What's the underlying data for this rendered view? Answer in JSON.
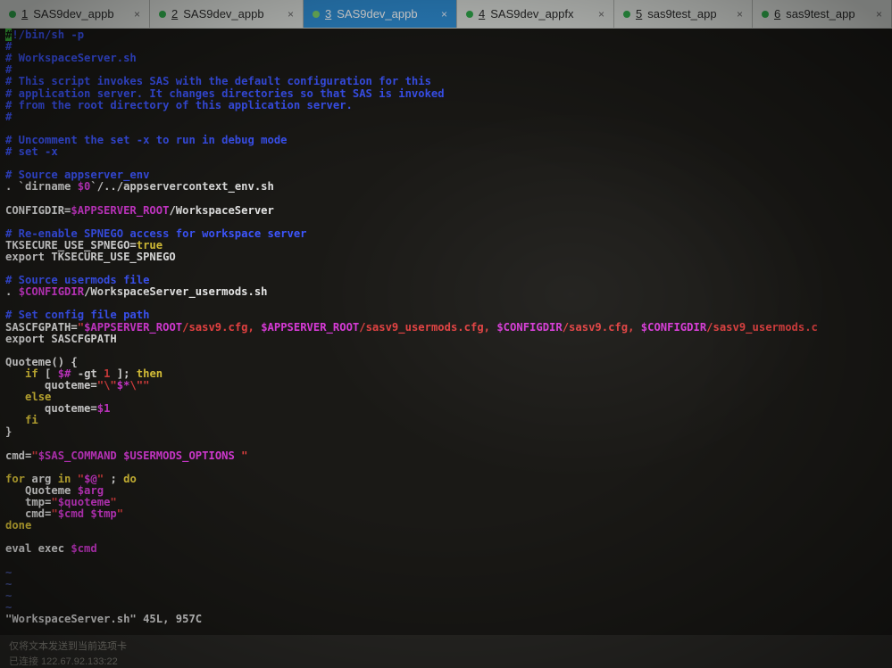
{
  "tabs": [
    {
      "num": "1",
      "label": "SAS9dev_appb",
      "active": false
    },
    {
      "num": "2",
      "label": "SAS9dev_appb",
      "active": false
    },
    {
      "num": "3",
      "label": "SAS9dev_appb",
      "active": true
    },
    {
      "num": "4",
      "label": "SAS9dev_appfx",
      "active": false
    },
    {
      "num": "5",
      "label": "sas9test_app",
      "active": false
    },
    {
      "num": "6",
      "label": "sas9test_app",
      "active": false
    }
  ],
  "colors": {
    "comment": "#3d56ff",
    "text": "#e6e6e6",
    "variable": "#d63ad6",
    "string": "#e04040",
    "keyword": "#e0c83a",
    "tilde": "#4a5aa8",
    "active_tab": "#2f8fd6"
  },
  "terminal": {
    "lines": [
      [
        {
          "t": "#",
          "c": "cur"
        },
        {
          "t": "!/bin/sh -p",
          "c": "com"
        }
      ],
      [
        {
          "t": "#",
          "c": "com"
        }
      ],
      [
        {
          "t": "# WorkspaceServer.sh",
          "c": "com"
        }
      ],
      [
        {
          "t": "#",
          "c": "com"
        }
      ],
      [
        {
          "t": "# This script invokes SAS with the default configuration for this",
          "c": "com"
        }
      ],
      [
        {
          "t": "# application server. It changes directories so that SAS is invoked",
          "c": "com"
        }
      ],
      [
        {
          "t": "# from the root directory of this application server.",
          "c": "com"
        }
      ],
      [
        {
          "t": "#",
          "c": "com"
        }
      ],
      [],
      [
        {
          "t": "# Uncomment the set -x to run in debug mode",
          "c": "com"
        }
      ],
      [
        {
          "t": "# set -x",
          "c": "com"
        }
      ],
      [],
      [
        {
          "t": "# Source appserver_env",
          "c": "com"
        }
      ],
      [
        {
          "t": ". `dirname ",
          "c": "txt"
        },
        {
          "t": "$0",
          "c": "var"
        },
        {
          "t": "`/../appservercontext_env.sh",
          "c": "txt"
        }
      ],
      [],
      [
        {
          "t": "CONFIGDIR=",
          "c": "txt"
        },
        {
          "t": "$APPSERVER_ROOT",
          "c": "var"
        },
        {
          "t": "/WorkspaceServer",
          "c": "txt"
        }
      ],
      [],
      [
        {
          "t": "# Re-enable SPNEGO access for workspace server",
          "c": "com"
        }
      ],
      [
        {
          "t": "TKSECURE_USE_SPNEGO=",
          "c": "txt"
        },
        {
          "t": "true",
          "c": "kw"
        }
      ],
      [
        {
          "t": "export TKSECURE_USE_SPNEGO",
          "c": "txt"
        }
      ],
      [],
      [
        {
          "t": "# Source usermods file",
          "c": "com"
        }
      ],
      [
        {
          "t": ". ",
          "c": "txt"
        },
        {
          "t": "$CONFIGDIR",
          "c": "var"
        },
        {
          "t": "/WorkspaceServer_usermods.sh",
          "c": "txt"
        }
      ],
      [],
      [
        {
          "t": "# Set config file path",
          "c": "com"
        }
      ],
      [
        {
          "t": "SASCFGPATH=",
          "c": "txt"
        },
        {
          "t": "\"",
          "c": "str"
        },
        {
          "t": "$APPSERVER_ROOT",
          "c": "var"
        },
        {
          "t": "/sasv9.cfg, ",
          "c": "str"
        },
        {
          "t": "$APPSERVER_ROOT",
          "c": "var"
        },
        {
          "t": "/sasv9_usermods.cfg, ",
          "c": "str"
        },
        {
          "t": "$CONFIGDIR",
          "c": "var"
        },
        {
          "t": "/sasv9.cfg, ",
          "c": "str"
        },
        {
          "t": "$CONFIGDIR",
          "c": "var"
        },
        {
          "t": "/sasv9_usermods.c",
          "c": "str"
        }
      ],
      [
        {
          "t": "export SASCFGPATH",
          "c": "txt"
        }
      ],
      [],
      [
        {
          "t": "Quoteme() {",
          "c": "txt"
        }
      ],
      [
        {
          "t": "   ",
          "c": "txt"
        },
        {
          "t": "if",
          "c": "kw"
        },
        {
          "t": " [ ",
          "c": "txt"
        },
        {
          "t": "$#",
          "c": "var"
        },
        {
          "t": " -gt ",
          "c": "txt"
        },
        {
          "t": "1",
          "c": "str"
        },
        {
          "t": " ]; ",
          "c": "txt"
        },
        {
          "t": "then",
          "c": "kw"
        }
      ],
      [
        {
          "t": "      quoteme=",
          "c": "txt"
        },
        {
          "t": "\"\\\"",
          "c": "str"
        },
        {
          "t": "$*",
          "c": "var"
        },
        {
          "t": "\\\"\"",
          "c": "str"
        }
      ],
      [
        {
          "t": "   ",
          "c": "txt"
        },
        {
          "t": "else",
          "c": "kw"
        }
      ],
      [
        {
          "t": "      quoteme=",
          "c": "txt"
        },
        {
          "t": "$1",
          "c": "var"
        }
      ],
      [
        {
          "t": "   ",
          "c": "txt"
        },
        {
          "t": "fi",
          "c": "kw"
        }
      ],
      [
        {
          "t": "}",
          "c": "txt"
        }
      ],
      [],
      [
        {
          "t": "cmd=",
          "c": "txt"
        },
        {
          "t": "\"",
          "c": "str"
        },
        {
          "t": "$SAS_COMMAND $USERMODS_OPTIONS",
          "c": "var"
        },
        {
          "t": " \"",
          "c": "str"
        }
      ],
      [],
      [
        {
          "t": "for",
          "c": "kw"
        },
        {
          "t": " arg ",
          "c": "txt"
        },
        {
          "t": "in",
          "c": "kw"
        },
        {
          "t": " \"",
          "c": "str"
        },
        {
          "t": "$@",
          "c": "var"
        },
        {
          "t": "\"",
          "c": "str"
        },
        {
          "t": " ; ",
          "c": "txt"
        },
        {
          "t": "do",
          "c": "kw"
        }
      ],
      [
        {
          "t": "   Quoteme ",
          "c": "txt"
        },
        {
          "t": "$arg",
          "c": "var"
        }
      ],
      [
        {
          "t": "   tmp=",
          "c": "txt"
        },
        {
          "t": "\"",
          "c": "str"
        },
        {
          "t": "$quoteme",
          "c": "var"
        },
        {
          "t": "\"",
          "c": "str"
        }
      ],
      [
        {
          "t": "   cmd=",
          "c": "txt"
        },
        {
          "t": "\"",
          "c": "str"
        },
        {
          "t": "$cmd $tmp",
          "c": "var"
        },
        {
          "t": "\"",
          "c": "str"
        }
      ],
      [
        {
          "t": "done",
          "c": "kw"
        }
      ],
      [],
      [
        {
          "t": "eval exec ",
          "c": "txt"
        },
        {
          "t": "$cmd",
          "c": "var"
        }
      ],
      [],
      [
        {
          "t": "~",
          "c": "tl"
        }
      ],
      [
        {
          "t": "~",
          "c": "tl"
        }
      ],
      [
        {
          "t": "~",
          "c": "tl"
        }
      ],
      [
        {
          "t": "~",
          "c": "tl"
        }
      ],
      [
        {
          "t": "\"WorkspaceServer.sh\" 45L, 957C",
          "c": "txt"
        }
      ]
    ]
  },
  "statusbar": {
    "line1": "仅将文本发送到当前选项卡",
    "line2": "已连接 122.67.92.133:22"
  }
}
